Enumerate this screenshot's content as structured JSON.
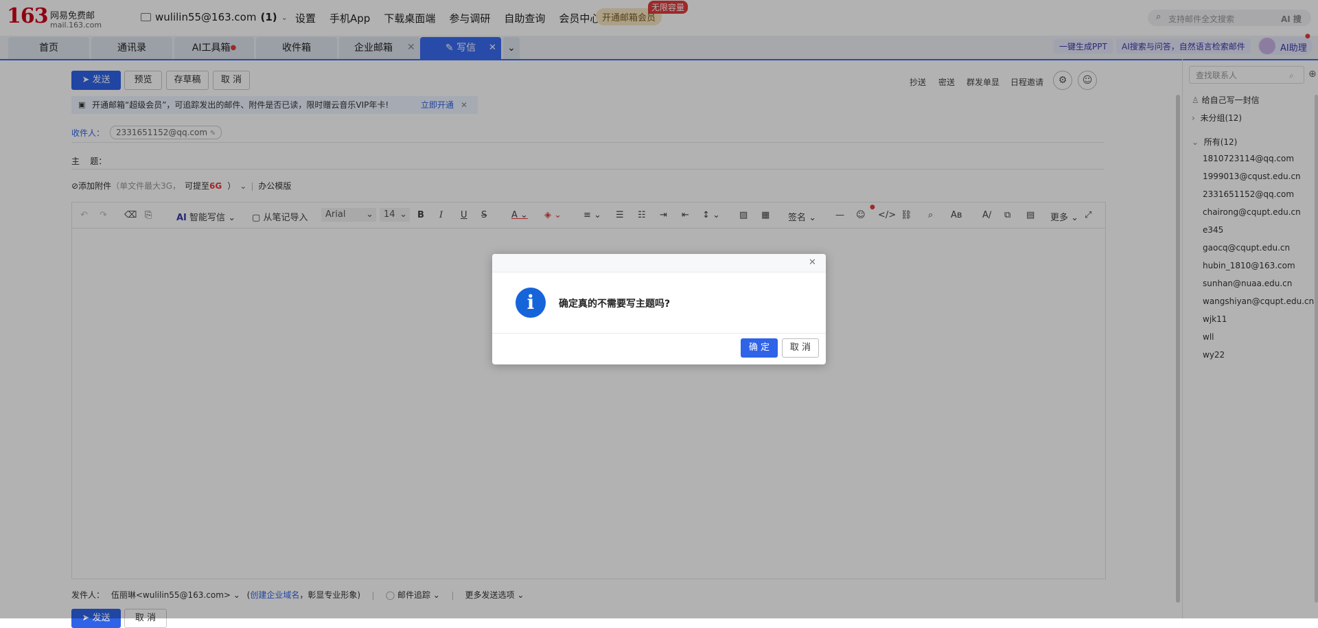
{
  "brand": {
    "logo": "163",
    "name_cn": "网易免费邮",
    "url": "mail.163.com"
  },
  "account": {
    "email": "wulilin55@163.com",
    "count": "(1)"
  },
  "topnav": [
    "设置",
    "手机App",
    "下载桌面端",
    "参与调研",
    "自助查询",
    "会员中心"
  ],
  "vip": {
    "button": "开通邮箱会员",
    "badge": "无限容量"
  },
  "search": {
    "placeholder": "支持邮件全文搜索",
    "ai": "AI 搜"
  },
  "tabs": [
    {
      "label": "首页"
    },
    {
      "label": "通讯录"
    },
    {
      "label": "AI工具箱"
    },
    {
      "label": "收件箱"
    },
    {
      "label": "企业邮箱"
    },
    {
      "label": "写信"
    }
  ],
  "right_links": {
    "ppt": "一键生成PPT",
    "ai_search": "AI搜索与问答，自然语言检索邮件",
    "ai_helper": "AI助理"
  },
  "compose": {
    "send": "发送",
    "preview": "预览",
    "draft": "存草稿",
    "cancel": "取 消",
    "ops": [
      "抄送",
      "密送",
      "群发单显",
      "日程邀请"
    ],
    "promo": "开通邮箱“超级会员”，可追踪发出的邮件、附件是否已读，限时赠云音乐VIP年卡!",
    "promo_link": "立即开通",
    "to_label": "收件人：",
    "to_chip": "2331651152@qq.com",
    "subject_label": "主    题：",
    "attach": "添加附件",
    "attach_note": "（单文件最大3G，",
    "attach_upgrade": "可提至",
    "attach_size": "6G",
    "attach_end": "）",
    "template": "办公模版",
    "toolbar": {
      "ai_write": "智能写信",
      "notes": "从笔记导入",
      "font": "Arial",
      "size": "14",
      "sign": "签名",
      "more": "更多"
    },
    "footer": {
      "sender_label": "发件人：",
      "sender": "伍丽琳<wulilin55@163.com>",
      "domain_link": "创建企业域名",
      "domain_note": "，彰显专业形象",
      "track": "邮件追踪",
      "more_opts": "更多发送选项"
    }
  },
  "contacts": {
    "search_placeholder": "查找联系人",
    "self": "给自己写一封信",
    "ungrouped": "未分组(12)",
    "all": "所有(12)",
    "list": [
      "1810723114@qq.com",
      "1999013@cqust.edu.cn",
      "2331651152@qq.com",
      "chairong@cqupt.edu.cn",
      "e345",
      "gaocq@cqupt.edu.cn",
      "hubin_1810@163.com",
      "sunhan@nuaa.edu.cn",
      "wangshiyan@cqupt.edu.cn",
      "wjk11",
      "wll",
      "wy22"
    ]
  },
  "dialog": {
    "message": "确定真的不需要写主题吗?",
    "ok": "确 定",
    "cancel": "取 消",
    "info_glyph": "i"
  },
  "colors": {
    "accent": "#3a6cf4",
    "primary_button": "#2f63e8",
    "info": "#1664d9",
    "brand_red": "#d0021b"
  }
}
